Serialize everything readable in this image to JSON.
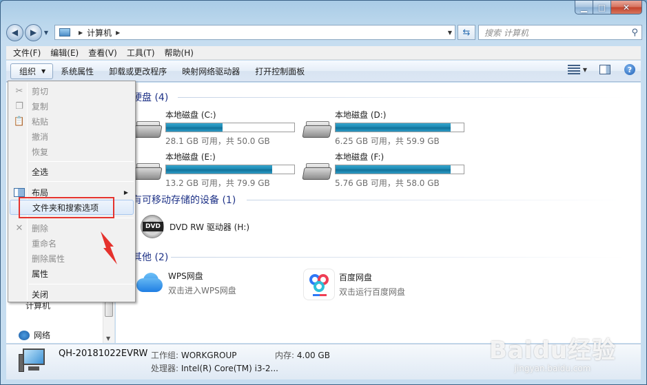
{
  "window": {
    "caption_min": "▁",
    "caption_max": "□",
    "caption_close": "✕"
  },
  "address": {
    "path": "计算机",
    "search_placeholder": "搜索 计算机"
  },
  "menubar": {
    "items": [
      "文件(F)",
      "编辑(E)",
      "查看(V)",
      "工具(T)",
      "帮助(H)"
    ]
  },
  "cmdbar": {
    "organize": "组织",
    "items": [
      "系统属性",
      "卸载或更改程序",
      "映射网络驱动器",
      "打开控制面板"
    ]
  },
  "context_menu": {
    "cut": "剪切",
    "copy": "复制",
    "paste": "粘贴",
    "undo": "撤消",
    "redo": "恢复",
    "select_all": "全选",
    "layout": "布局",
    "folder_options": "文件夹和搜索选项",
    "delete": "删除",
    "rename": "重命名",
    "remove_props": "删除属性",
    "properties": "属性",
    "close": "关闭"
  },
  "nav": {
    "computer": "计算机",
    "network": "网络"
  },
  "groups": {
    "hdd": "硬盘 (4)",
    "removable": "有可移动存储的设备 (1)",
    "other": "其他 (2)"
  },
  "drives": [
    {
      "name": "本地磁盘 (C:)",
      "free_text": "28.1 GB 可用，共 50.0 GB",
      "used_fraction": 0.44
    },
    {
      "name": "本地磁盘 (D:)",
      "free_text": "6.25 GB 可用，共 59.9 GB",
      "used_fraction": 0.9
    },
    {
      "name": "本地磁盘 (E:)",
      "free_text": "13.2 GB 可用，共 79.9 GB",
      "used_fraction": 0.83
    },
    {
      "name": "本地磁盘 (F:)",
      "free_text": "5.76 GB 可用，共 58.0 GB",
      "used_fraction": 0.9
    }
  ],
  "dvd": {
    "name": "DVD RW 驱动器 (H:)",
    "label": "DVD"
  },
  "others": [
    {
      "name": "WPS网盘",
      "sub": "双击进入WPS网盘"
    },
    {
      "name": "百度网盘",
      "sub": "双击运行百度网盘"
    }
  ],
  "details": {
    "pc_name": "QH-20181022EVRW",
    "workgroup_label": "工作组:",
    "workgroup": "WORKGROUP",
    "memory_label": "内存:",
    "memory": "4.00 GB",
    "cpu_label": "处理器:",
    "cpu": "Intel(R) Core(TM) i3-2..."
  },
  "watermark": {
    "logo": "Baidu经验",
    "url": "jingyan.baidu.com"
  },
  "colors": {
    "annotation_red": "#e5322d",
    "bar_fill": "#1b84ad"
  }
}
